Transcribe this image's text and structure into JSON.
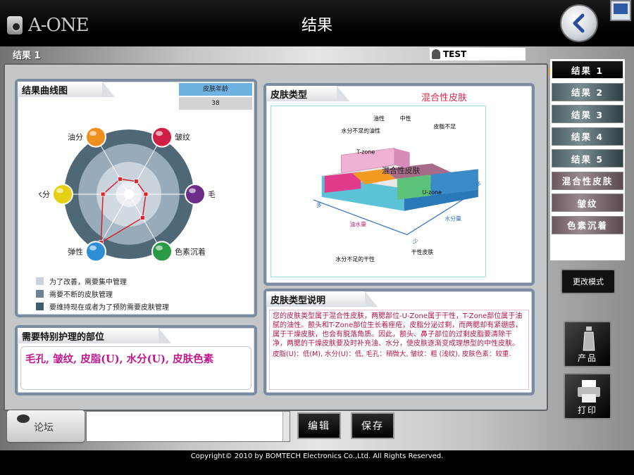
{
  "header": {
    "logo_text": "A-ONE",
    "title": "结果",
    "back_icon": "chevron-left-icon",
    "minimize_icon": "minimize-icon"
  },
  "subheader": {
    "result_label": "结果 1",
    "user_name": "TEST"
  },
  "curve_panel": {
    "title": "结果曲线图",
    "score_label": "皮肤年龄",
    "score_value": "38",
    "axes": [
      {
        "label": "油分",
        "color": "#ef8f1e",
        "value": 0.27
      },
      {
        "label": "皱纹",
        "color": "#d01f47",
        "value": 0.23
      },
      {
        "label": "毛孔",
        "color": "#6b2d87",
        "value": 0.26
      },
      {
        "label": "色素沉着",
        "color": "#2a9a45",
        "value": 0.42
      },
      {
        "label": "弹性",
        "color": "#2e8fd6",
        "value": 0.86
      },
      {
        "label": "水分",
        "color": "#e5d014",
        "value": 0.4
      }
    ],
    "legend": [
      {
        "label": "为了改善，需要集中管理",
        "color": "#c9d3dc"
      },
      {
        "label": "需要不断的皮肤管理",
        "color": "#6c8397"
      },
      {
        "label": "要维持现在或者为了预防需要皮肤管理",
        "color": "#3f5c6f"
      }
    ]
  },
  "care_panel": {
    "title": "需要特别护理的部位",
    "items_text": "毛孔, 皱纹, 皮脂(U), 水分(U), 皮肤色素"
  },
  "type_panel": {
    "title": "皮肤类型",
    "result": "混合性皮肤",
    "diagram": {
      "oily": "油性",
      "neutral": "中性",
      "dehydrated_oily": "水分不足的油性",
      "lacking_oil": "皮脂不足",
      "tzone": "T-zone",
      "uzone": "U-zone",
      "combination": "混合性皮肤",
      "oil_amount": "油水量",
      "moisture_amount": "水分量",
      "dehydrated_dry": "水分不足的干性",
      "dry": "干性皮肤",
      "more_left": "多",
      "more_right": "多",
      "less": "少"
    }
  },
  "desc_panel": {
    "title": "皮肤类型说明",
    "text": "您的皮肤类型属于混合性皮肤，两腮部位-U-Zone属于干性，T-Zone部位属于油腻的油性。额头和T-Zone部位生长着痤疮，皮脂分泌过剩，而两腮却有紧绷感，属于干燥皮肤，也会有脱落角质。因此，额头、鼻子部位的过剩皮脂要清除干净，两腮的干燥皮肤要及时补充油、水分，使皮肤逐渐变成理想型的中性皮肤。",
    "detail": "皮脂(U)：低(M), 水分(U)：低, 毛孔：稍微大, 皱纹：粗 (浅纹), 皮肤色素：较重."
  },
  "nav": {
    "items": [
      "结果 1",
      "结果 2",
      "结果 3",
      "结果 4",
      "结果 5",
      "混合性皮肤",
      "皱纹",
      "色素沉着"
    ],
    "active_index": 0
  },
  "actions": {
    "mode_label": "更改模式",
    "product_label": "产品",
    "print_label": "打印"
  },
  "bottom": {
    "forum_label": "论坛",
    "edit_label": "编辑",
    "save_label": "保存"
  },
  "footer": {
    "copyright": "Copyright© 2010 by BOMTECH Electronics Co.,Ltd. All Rights Reserved."
  }
}
